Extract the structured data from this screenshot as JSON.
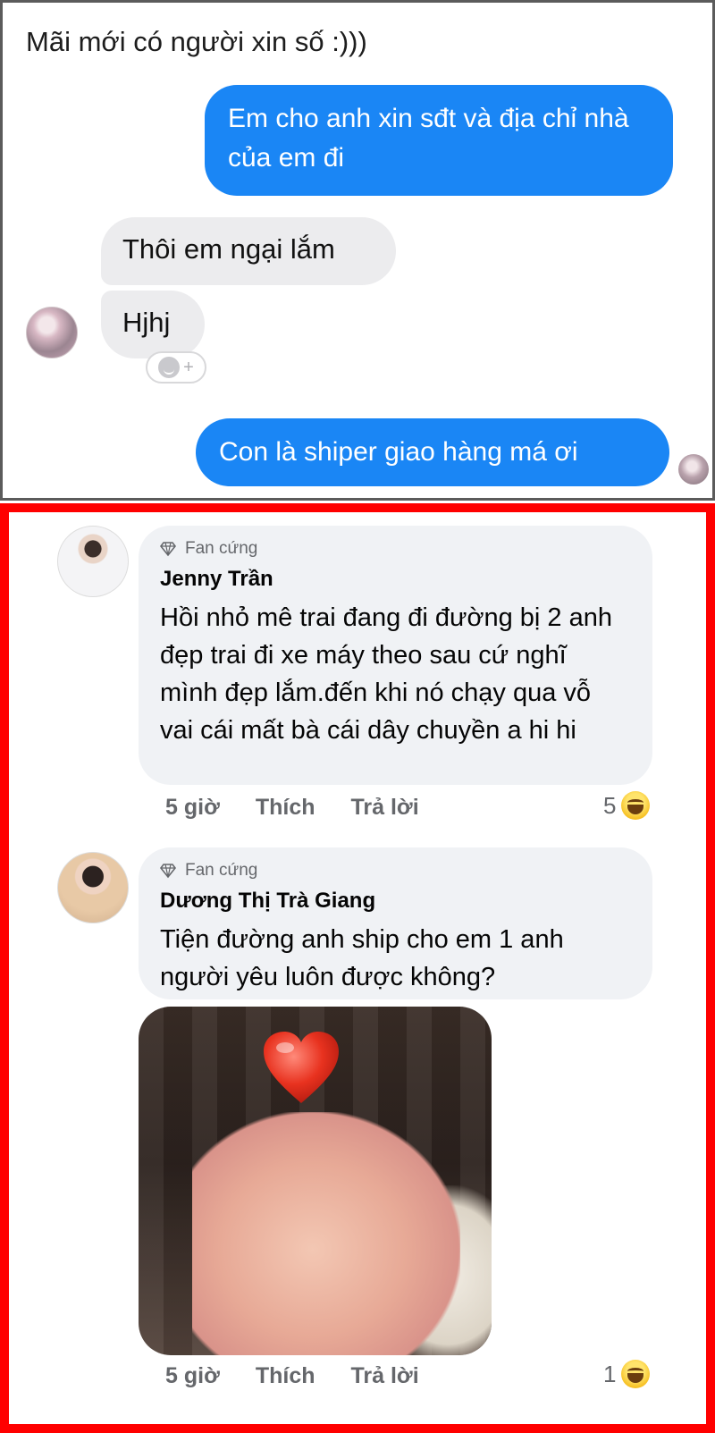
{
  "chat": {
    "caption": "Mãi mới có người xin số :)))",
    "messages": [
      {
        "side": "out",
        "text": "Em cho anh xin sđt và địa chỉ nhà của em đi"
      },
      {
        "side": "in",
        "text": "Thôi em ngại lắm"
      },
      {
        "side": "in",
        "text": "Hjhj"
      },
      {
        "side": "out",
        "text": "Con là shiper giao hàng má ơi"
      }
    ],
    "react_add": "+",
    "colors": {
      "outgoing": "#1a86f5",
      "incoming": "#ececee"
    }
  },
  "comments": [
    {
      "badge": "Fan cứng",
      "author": "Jenny Trần",
      "text": "Hồi nhỏ mê trai đang đi đường bị 2 anh đẹp trai đi xe máy theo sau cứ nghĩ mình đẹp lắm.đến khi nó chạy qua vỗ vai cái mất bà cái dây chuyền a hi hi",
      "time": "5 giờ",
      "like": "Thích",
      "reply": "Trả lời",
      "reaction_count": "5",
      "reaction_icon": "haha-icon"
    },
    {
      "badge": "Fan cứng",
      "author": "Dương Thị Trà Giang",
      "text": "Tiện đường anh ship cho em 1 anh người yêu luôn được không?",
      "time": "5 giờ",
      "like": "Thích",
      "reply": "Trả lời",
      "reaction_count": "1",
      "reaction_icon": "haha-icon"
    }
  ],
  "frame_color": "#ff0000"
}
